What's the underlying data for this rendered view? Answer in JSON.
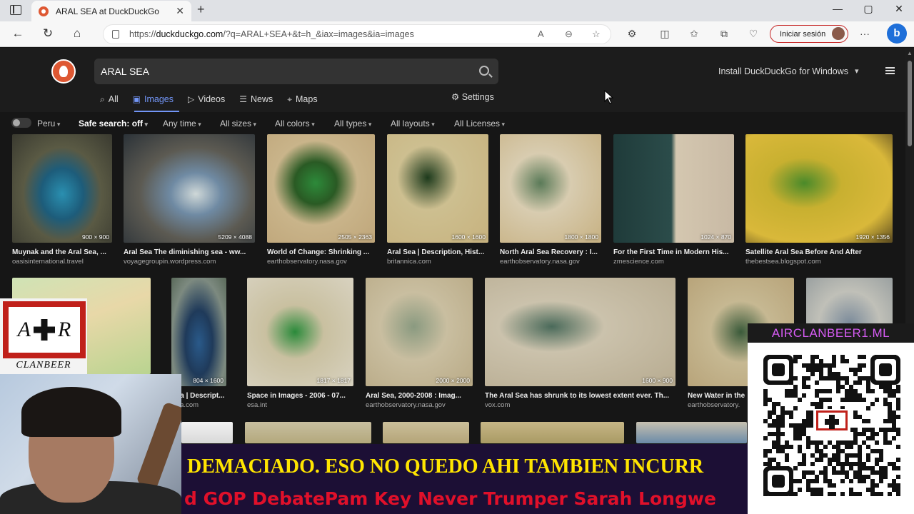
{
  "browser": {
    "tab_title": "ARAL SEA at DuckDuckGo",
    "url_prefix": "https://",
    "url_host": "duckduckgo.com",
    "url_rest": "/?q=ARAL+SEA+&t=h_&iax=images&ia=images",
    "signin_label": "Iniciar sesión"
  },
  "ddg": {
    "query": "ARAL SEA",
    "install_label": "Install DuckDuckGo for Windows",
    "tabs": [
      "All",
      "Images",
      "Videos",
      "News",
      "Maps"
    ],
    "settings_label": "Settings",
    "filters": {
      "region": "Peru",
      "safe_search": "Safe search: off",
      "time": "Any time",
      "sizes": "All sizes",
      "colors": "All colors",
      "types": "All types",
      "layouts": "All layouts",
      "licenses": "All Licenses"
    }
  },
  "results": [
    {
      "dims": "900 × 900",
      "title": "Muynak and the Aral Sea, ...",
      "source": "oasisinternational.travel"
    },
    {
      "dims": "5209 × 4088",
      "title": "Aral Sea The diminishing sea - ww...",
      "source": "voyagegroupin.wordpress.com"
    },
    {
      "dims": "2505 × 2363",
      "title": "World of Change: Shrinking ...",
      "source": "earthobservatory.nasa.gov"
    },
    {
      "dims": "1600 × 1600",
      "title": "Aral Sea | Description, Hist...",
      "source": "britannica.com"
    },
    {
      "dims": "1800 × 1800",
      "title": "North Aral Sea Recovery : I...",
      "source": "earthobservatory.nasa.gov"
    },
    {
      "dims": "1024 × 870",
      "title": "For the First Time in Modern His...",
      "source": "zmescience.com"
    },
    {
      "dims": "1920 × 1356",
      "title": "Satellite Aral Sea Before And After",
      "source": "thebestsea.blogspot.com"
    },
    {
      "dims": "",
      "title": "",
      "source": ""
    },
    {
      "dims": "804 × 1600",
      "title": "Sea | Descript...",
      "source": "nica.com"
    },
    {
      "dims": "1817 × 1817",
      "title": "Space in Images - 2006 - 07...",
      "source": "esa.int"
    },
    {
      "dims": "2000 × 2000",
      "title": "Aral Sea, 2000-2008 : Imag...",
      "source": "earthobservatory.nasa.gov"
    },
    {
      "dims": "1600 × 900",
      "title": "The Aral Sea has shrunk to its lowest extent ever. Th...",
      "source": "vox.com"
    },
    {
      "dims": "",
      "title": "New Water in the",
      "source": "earthobservatory."
    }
  ],
  "overlay": {
    "logo_left": "A",
    "logo_right": "R",
    "logo_text": "CLANBEER",
    "qr_header": "AIRCLANBEER1.ML",
    "ticker_line1": "DEMACIADO. ESO NO QUEDO AHI TAMBIEN INCURR",
    "ticker_line2": "d GOP DebatePam Key Never Trumper Sarah Longwe"
  }
}
